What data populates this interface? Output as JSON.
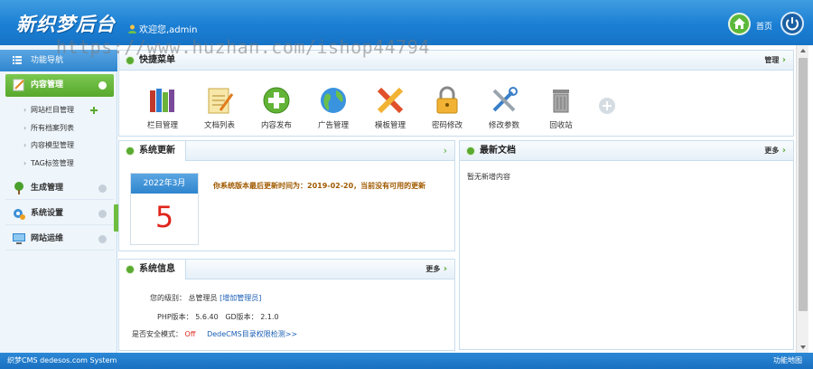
{
  "header": {
    "logo": "新织梦后台",
    "welcome": "欢迎您,admin",
    "home_label": "首页",
    "watermark": "https://www.huzhan.com/ishop44794"
  },
  "sidebar": {
    "nav_title": "功能导航",
    "active_section": "内容管理",
    "sub_items": [
      "网站栏目管理",
      "所有档案列表",
      "内容模型管理",
      "TAG标签管理"
    ],
    "sections": [
      "生成管理",
      "系统设置",
      "网站运维"
    ]
  },
  "quick_menu": {
    "title": "快捷菜单",
    "manage_label": "管理",
    "items": [
      {
        "label": "栏目管理",
        "icon": "books-icon"
      },
      {
        "label": "文档列表",
        "icon": "notepad-icon"
      },
      {
        "label": "内容发布",
        "icon": "plus-circle-icon"
      },
      {
        "label": "广告管理",
        "icon": "globe-icon"
      },
      {
        "label": "模板管理",
        "icon": "pencil-ruler-icon"
      },
      {
        "label": "密码修改",
        "icon": "lock-icon"
      },
      {
        "label": "修改参数",
        "icon": "tools-icon"
      },
      {
        "label": "回收站",
        "icon": "trash-icon"
      }
    ]
  },
  "system_update": {
    "title": "系统更新",
    "calendar_month": "2022年3月",
    "calendar_day": "5",
    "message": "你系统版本最后更新时间为：2019-02-20，当前没有可用的更新"
  },
  "latest_docs": {
    "title": "最新文档",
    "more_label": "更多",
    "empty_text": "暂无新增内容"
  },
  "system_info": {
    "title": "系统信息",
    "more_label": "更多",
    "level_label": "您的级别：",
    "level_value": "总管理员",
    "level_link": "[增加管理员]",
    "php_label": "PHP版本：",
    "php_value": "5.6.40",
    "gd_label": "GD版本：",
    "gd_value": "2.1.0",
    "safe_label": "是否安全模式：",
    "safe_value": "Off",
    "safe_link": "DedeCMS目录权限检测>>"
  },
  "footer": {
    "left": "织梦CMS  dedesos.com System",
    "right": "功能地图"
  },
  "colors": {
    "header_blue": "#1b7fd4",
    "active_green": "#57a82d",
    "accent_red": "#e0241b"
  }
}
